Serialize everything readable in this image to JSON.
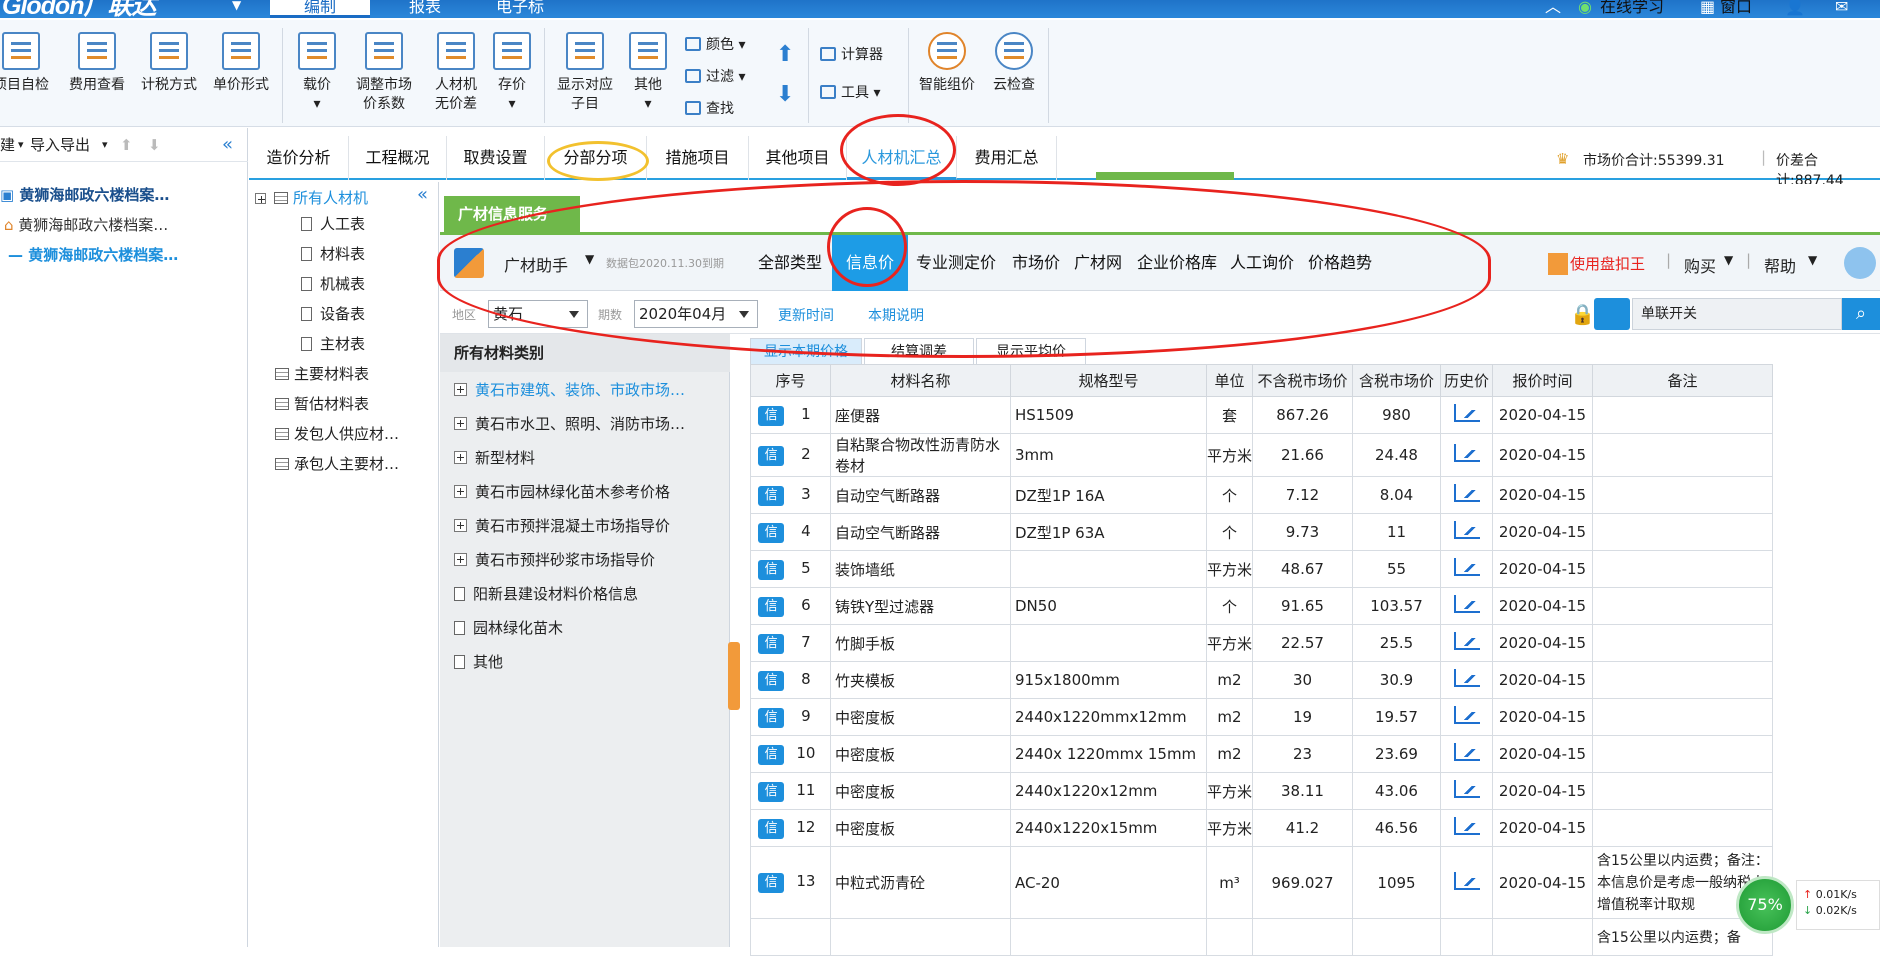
{
  "app": {
    "logo": "Glodon广联达"
  },
  "menu": {
    "tabs": [
      "编制",
      "报表",
      "电子标"
    ],
    "right": [
      "在线学习",
      "窗口"
    ]
  },
  "ribbon": {
    "buttons": [
      "项目自检",
      "费用查看",
      "计税方式",
      "单价形式",
      "载价",
      "调整市场价系数",
      "人材机无价差",
      "存价",
      "显示对应子目",
      "其他",
      "智能组价",
      "云检查"
    ],
    "small": [
      "颜色",
      "过滤",
      "查找",
      "计算器",
      "工具"
    ]
  },
  "leftpanel": {
    "toolbar": [
      "建",
      "导入导出"
    ],
    "projects": [
      "黄狮海邮政六楼档案…",
      "黄狮海邮政六楼档案…",
      "黄狮海邮政六楼档案…"
    ]
  },
  "maintabs": [
    "造价分析",
    "工程概况",
    "取费设置",
    "分部分项",
    "措施项目",
    "其他项目",
    "人材机汇总",
    "费用汇总"
  ],
  "summary": {
    "market": "市场价合计:55399.31",
    "diff": "价差合计:887.44"
  },
  "tree": {
    "root": "所有人材机",
    "items": [
      "人工表",
      "材料表",
      "机械表",
      "设备表",
      "主材表",
      "主要材料表",
      "暂估材料表",
      "发包人供应材…",
      "承包人主要材…"
    ]
  },
  "gc": {
    "header": "广材信息服务",
    "helper": "广材助手",
    "expiry": "数据包2020.11.30到期",
    "nav": [
      "全部类型",
      "信息价",
      "专业测定价",
      "市场价",
      "广材网",
      "企业价格库",
      "人工询价",
      "价格趋势"
    ],
    "right": [
      "使用盘扣王",
      "购买",
      "帮助"
    ],
    "filters": {
      "region_label": "地区",
      "region": "黄石",
      "period_label": "期数",
      "period": "2020年04月",
      "update": "更新时间",
      "note": "本期说明",
      "switch_placeholder": "单联开关"
    },
    "cat_title": "所有材料类别",
    "categories": [
      {
        "label": "黄石市建筑、装饰、市政市场…",
        "type": "plus",
        "active": true
      },
      {
        "label": "黄石市水卫、照明、消防市场…",
        "type": "plus"
      },
      {
        "label": "新型材料",
        "type": "plus"
      },
      {
        "label": "黄石市园林绿化苗木参考价格",
        "type": "plus"
      },
      {
        "label": "黄石市预拌混凝土市场指导价",
        "type": "plus"
      },
      {
        "label": "黄石市预拌砂浆市场指导价",
        "type": "plus"
      },
      {
        "label": "阳新县建设材料价格信息",
        "type": "doc"
      },
      {
        "label": "园林绿化苗木",
        "type": "doc"
      },
      {
        "label": "其他",
        "type": "doc"
      }
    ],
    "subtabs": [
      "显示本期价格",
      "结算调差",
      "显示平均价"
    ],
    "columns": [
      "序号",
      "材料名称",
      "规格型号",
      "单位",
      "不含税市场价",
      "含税市场价",
      "历史价",
      "报价时间",
      "备注"
    ],
    "badge": "信",
    "rows": [
      [
        "1",
        "座便器",
        "HS1509",
        "套",
        "867.26",
        "980",
        "2020-04-15",
        ""
      ],
      [
        "2",
        "自粘聚合物改性沥青防水卷材",
        "3mm",
        "平方米",
        "21.66",
        "24.48",
        "2020-04-15",
        ""
      ],
      [
        "3",
        "自动空气断路器",
        "DZ型1P 16A",
        "个",
        "7.12",
        "8.04",
        "2020-04-15",
        ""
      ],
      [
        "4",
        "自动空气断路器",
        "DZ型1P 63A",
        "个",
        "9.73",
        "11",
        "2020-04-15",
        ""
      ],
      [
        "5",
        "装饰墙纸",
        "",
        "平方米",
        "48.67",
        "55",
        "2020-04-15",
        ""
      ],
      [
        "6",
        "铸铁Y型过滤器",
        "DN50",
        "个",
        "91.65",
        "103.57",
        "2020-04-15",
        ""
      ],
      [
        "7",
        "竹脚手板",
        "",
        "平方米",
        "22.57",
        "25.5",
        "2020-04-15",
        ""
      ],
      [
        "8",
        "竹夹模板",
        "915x1800mm",
        "m2",
        "30",
        "30.9",
        "2020-04-15",
        ""
      ],
      [
        "9",
        "中密度板",
        "2440x1220mmx12mm",
        "m2",
        "19",
        "19.57",
        "2020-04-15",
        ""
      ],
      [
        "10",
        "中密度板",
        "2440x 1220mmx 15mm",
        "m2",
        "23",
        "23.69",
        "2020-04-15",
        ""
      ],
      [
        "11",
        "中密度板",
        "2440x1220x12mm",
        "平方米",
        "38.11",
        "43.06",
        "2020-04-15",
        ""
      ],
      [
        "12",
        "中密度板",
        "2440x1220x15mm",
        "平方米",
        "41.2",
        "46.56",
        "2020-04-15",
        ""
      ],
      [
        "13",
        "中粒式沥青砼",
        "AC-20",
        "m³",
        "969.027",
        "1095",
        "2020-04-15",
        "含15公里以内运费；备注：本信息价是考虑一般纳税人增值税率计取规"
      ]
    ],
    "lastrow_note": "含15公里以内运费；备"
  },
  "netspeed": {
    "percent": "75%",
    "up": "0.01K/s",
    "down": "0.02K/s"
  }
}
